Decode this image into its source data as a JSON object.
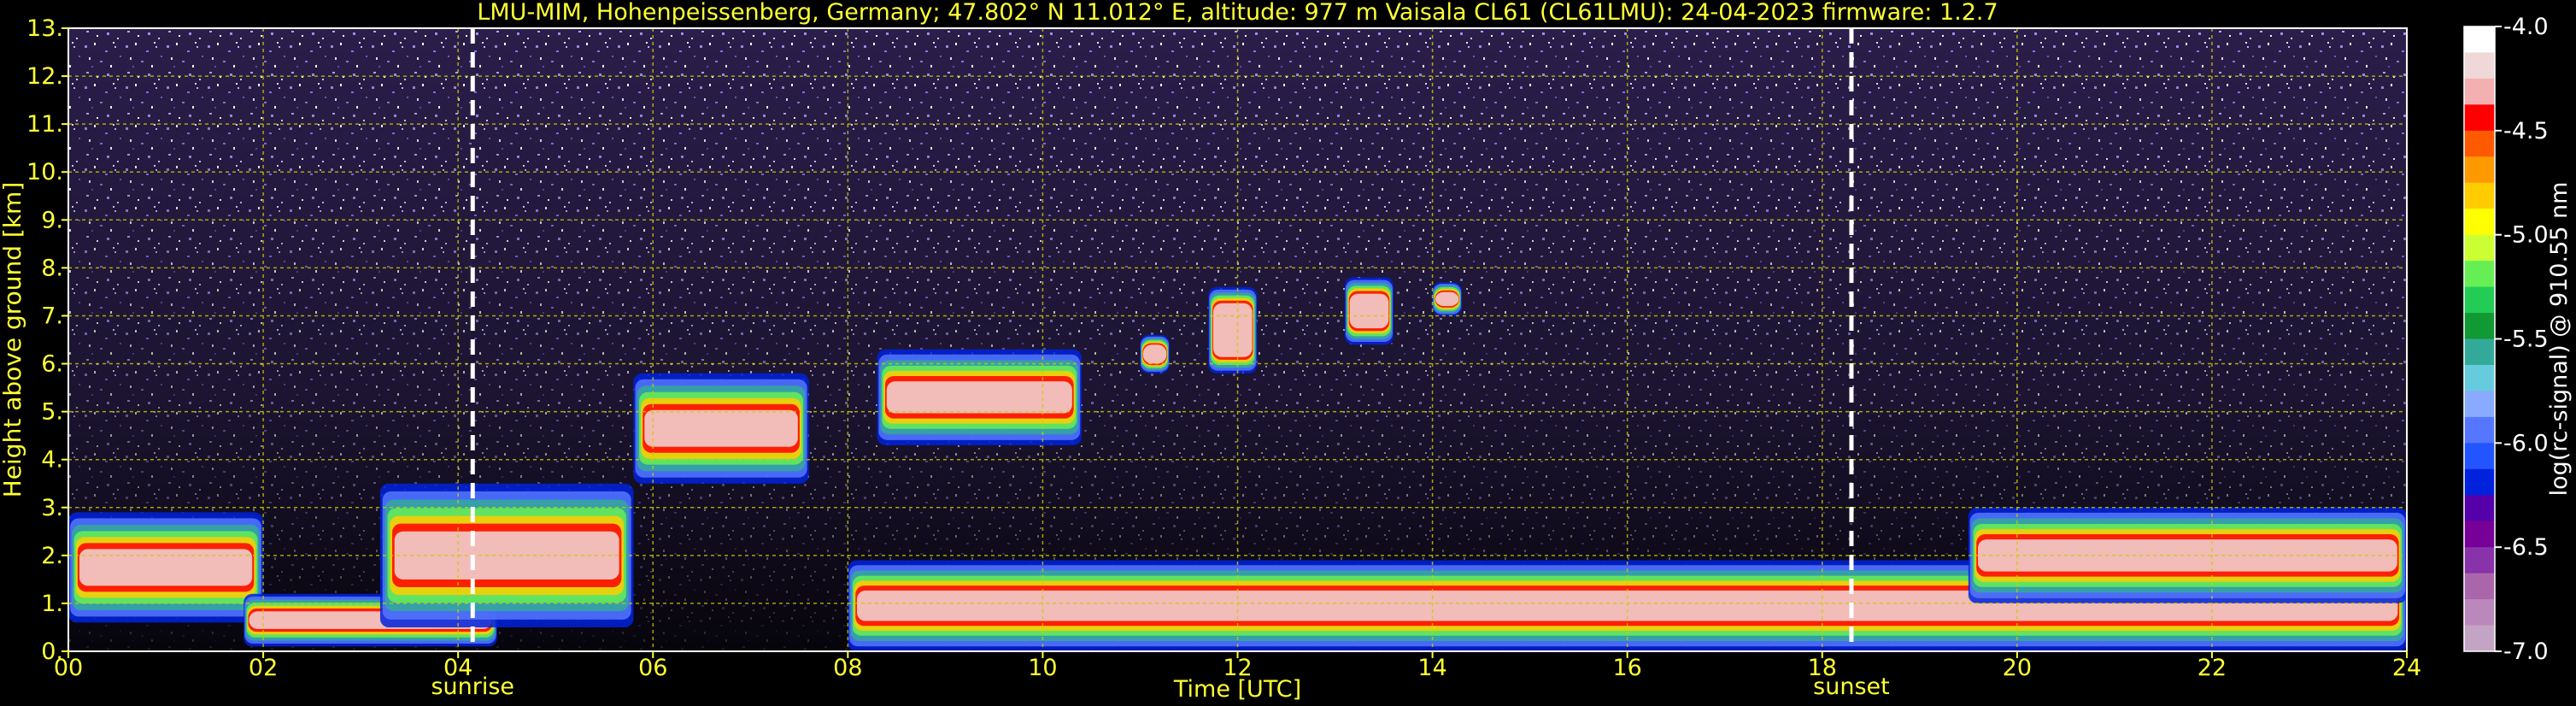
{
  "chart_data": {
    "type": "heatmap",
    "title": "LMU-MIM, Hohenpeissenberg, Germany; 47.802° N 11.012° E, altitude: 977 m    Vaisala CL61 (CL61LMU): 24-04-2023    firmware: 1.2.7",
    "xlabel": "Time [UTC]",
    "ylabel": "Height above ground [km]",
    "xlim": [
      0,
      24
    ],
    "ylim": [
      0,
      13
    ],
    "xticks": [
      "00",
      "02",
      "04",
      "06",
      "08",
      "10",
      "12",
      "14",
      "16",
      "18",
      "20",
      "22",
      "24"
    ],
    "yticks": [
      "0.",
      "1.",
      "2.",
      "3.",
      "4.",
      "5.",
      "6.",
      "7.",
      "8.",
      "9.",
      "10.",
      "11.",
      "12.",
      "13."
    ],
    "grid": true,
    "markers": [
      {
        "label": "sunrise",
        "x": 4.15
      },
      {
        "label": "sunset",
        "x": 18.3
      }
    ],
    "colorbar": {
      "label": "log(rc-signal) @ 910.55 nm",
      "range": [
        -7.0,
        -4.0
      ],
      "ticks": [
        "-4.0",
        "-4.5",
        "-5.0",
        "-5.5",
        "-6.0",
        "-6.5",
        "-7.0"
      ],
      "colors": [
        "#ffffff",
        "#f0d8d8",
        "#f4b0b0",
        "#ff0000",
        "#ff5a00",
        "#ff9900",
        "#ffcc00",
        "#ffff00",
        "#ccff33",
        "#66ee55",
        "#22cc55",
        "#119933",
        "#33aa99",
        "#66ccdd",
        "#88aaff",
        "#5577ff",
        "#2255ff",
        "#0022dd",
        "#5500aa",
        "#770099",
        "#8833aa",
        "#aa66aa",
        "#bb88bb",
        "#c4a4c4"
      ]
    },
    "cloud_layers": [
      {
        "x0": 0.0,
        "x1": 2.0,
        "y0": 0.6,
        "y1": 2.9
      },
      {
        "x0": 1.8,
        "x1": 4.4,
        "y0": 0.1,
        "y1": 1.2
      },
      {
        "x0": 3.2,
        "x1": 5.8,
        "y0": 0.5,
        "y1": 3.5
      },
      {
        "x0": 5.8,
        "x1": 7.6,
        "y0": 3.5,
        "y1": 5.8
      },
      {
        "x0": 8.3,
        "x1": 10.4,
        "y0": 4.3,
        "y1": 6.3
      },
      {
        "x0": 11.0,
        "x1": 11.3,
        "y0": 5.8,
        "y1": 6.6
      },
      {
        "x0": 11.7,
        "x1": 12.2,
        "y0": 5.8,
        "y1": 7.6
      },
      {
        "x0": 13.1,
        "x1": 13.6,
        "y0": 6.4,
        "y1": 7.8
      },
      {
        "x0": 14.0,
        "x1": 14.3,
        "y0": 7.0,
        "y1": 7.7
      },
      {
        "x0": 8.0,
        "x1": 24.0,
        "y0": 0.0,
        "y1": 1.9
      },
      {
        "x0": 19.5,
        "x1": 24.0,
        "y0": 1.0,
        "y1": 3.0
      }
    ]
  }
}
